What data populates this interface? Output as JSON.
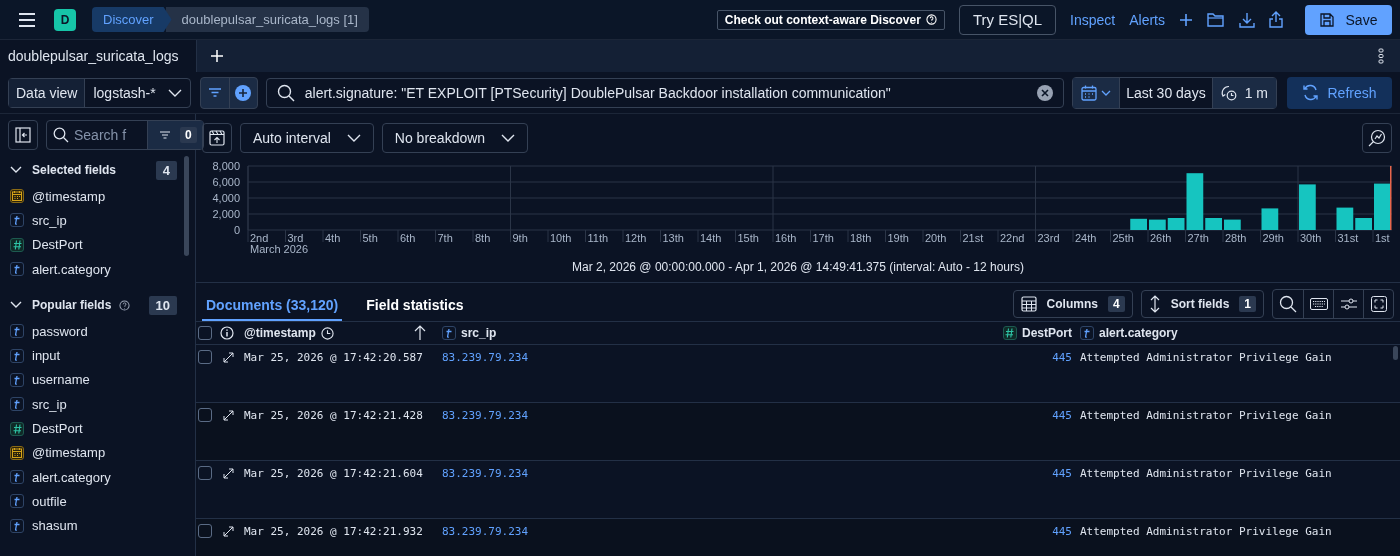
{
  "header": {
    "avatar": "D",
    "breadcrumbs": [
      {
        "label": "Discover",
        "selected": true
      },
      {
        "label": "doublepulsar_suricata_logs [1]",
        "selected": false
      }
    ],
    "promo": "Check out context-aware Discover",
    "esql_button": "Try ES|QL",
    "links": [
      "Inspect",
      "Alerts"
    ],
    "save_button": "Save"
  },
  "tabs": [
    {
      "label": "doublepulsar_suricata_logs",
      "selected": true
    }
  ],
  "query_bar": {
    "data_view_label": "Data view",
    "data_view": "logstash-*",
    "query": "alert.signature: \"ET EXPLOIT [PTSecurity] DoublePulsar Backdoor installation communication\"",
    "time_range": "Last 30 days",
    "refresh_interval": "1 m",
    "refresh_button": "Refresh"
  },
  "sidebar": {
    "search": {
      "placeholder": "Search f"
    },
    "filter_count": "0",
    "sections": [
      {
        "title": "Selected fields",
        "count": "4",
        "help": false,
        "fields": [
          {
            "name": "@timestamp",
            "kind": "date"
          },
          {
            "name": "src_ip",
            "kind": "string"
          },
          {
            "name": "DestPort",
            "kind": "number"
          },
          {
            "name": "alert.category",
            "kind": "string"
          }
        ]
      },
      {
        "title": "Popular fields",
        "count": "10",
        "help": true,
        "fields": [
          {
            "name": "password",
            "kind": "string"
          },
          {
            "name": "input",
            "kind": "string"
          },
          {
            "name": "username",
            "kind": "string"
          },
          {
            "name": "src_ip",
            "kind": "string"
          },
          {
            "name": "DestPort",
            "kind": "number"
          },
          {
            "name": "@timestamp",
            "kind": "date"
          },
          {
            "name": "alert.category",
            "kind": "string"
          },
          {
            "name": "outfile",
            "kind": "string"
          },
          {
            "name": "shasum",
            "kind": "string"
          }
        ]
      }
    ]
  },
  "chart_toolbar": {
    "interval": "Auto interval",
    "breakdown": "No breakdown"
  },
  "histogram": {
    "chart_data": {
      "type": "bar",
      "xlabel": "March 2026",
      "grid": true,
      "categories": [
        "2nd",
        "3rd",
        "4th",
        "5th",
        "6th",
        "7th",
        "8th",
        "9th",
        "10th",
        "11th",
        "12th",
        "13th",
        "14th",
        "15th",
        "16th",
        "17th",
        "18th",
        "19th",
        "20th",
        "21st",
        "22nd",
        "23rd",
        "24th",
        "25th",
        "26th",
        "27th",
        "28th",
        "29th",
        "30th",
        "31st",
        "1st"
      ],
      "series": [
        {
          "color": "#16c5c0",
          "values": [
            null,
            null,
            null,
            null,
            null,
            null,
            null,
            null,
            null,
            null,
            null,
            null,
            null,
            null,
            null,
            null,
            null,
            null,
            null,
            null,
            null,
            null,
            null,
            null,
            1300,
            7100,
            1300,
            2700,
            5700,
            2800,
            5800
          ]
        },
        {
          "color": "#16c5c0",
          "values": [
            null,
            null,
            null,
            null,
            null,
            null,
            null,
            null,
            null,
            null,
            null,
            null,
            null,
            null,
            null,
            null,
            null,
            null,
            null,
            null,
            null,
            null,
            null,
            1400,
            1500,
            1500,
            null,
            null,
            null,
            1500,
            null
          ]
        }
      ],
      "ylim": [
        0,
        8000
      ],
      "yticks": [
        {
          "value": 0,
          "label": "0"
        },
        {
          "value": 2000,
          "label": "2,000"
        },
        {
          "value": 4000,
          "label": "4,000"
        },
        {
          "value": 6000,
          "label": "6,000"
        },
        {
          "value": 8000,
          "label": "8,000"
        }
      ]
    },
    "range_text": "Mar 2, 2026 @ 00:00:00.000 - Apr 1, 2026 @ 14:49:41.375 (interval: Auto - 12 hours)"
  },
  "results": {
    "tabs": [
      {
        "label": "Documents (33,120)",
        "selected": true
      },
      {
        "label": "Field statistics",
        "selected": false
      }
    ],
    "columns_button": {
      "label": "Columns",
      "count": "4"
    },
    "sort_button": {
      "label": "Sort fields",
      "count": "1"
    },
    "select_all": {
      "checked": false
    },
    "columns": [
      {
        "name": "@timestamp",
        "kind": "date"
      },
      {
        "name": "src_ip",
        "kind": "string"
      },
      {
        "name": "DestPort",
        "kind": "number"
      },
      {
        "name": "alert.category",
        "kind": "string"
      }
    ],
    "rows": [
      {
        "selected": false,
        "cells": [
          "Mar 25, 2026 @ 17:42:20.587",
          "83.239.79.234",
          "445",
          "Attempted Administrator Privilege Gain"
        ]
      },
      {
        "selected": false,
        "cells": [
          "Mar 25, 2026 @ 17:42:21.428",
          "83.239.79.234",
          "445",
          "Attempted Administrator Privilege Gain"
        ]
      },
      {
        "selected": false,
        "cells": [
          "Mar 25, 2026 @ 17:42:21.604",
          "83.239.79.234",
          "445",
          "Attempted Administrator Privilege Gain"
        ]
      },
      {
        "selected": false,
        "cells": [
          "Mar 25, 2026 @ 17:42:21.932",
          "83.239.79.234",
          "445",
          "Attempted Administrator Privilege Gain"
        ]
      }
    ]
  }
}
